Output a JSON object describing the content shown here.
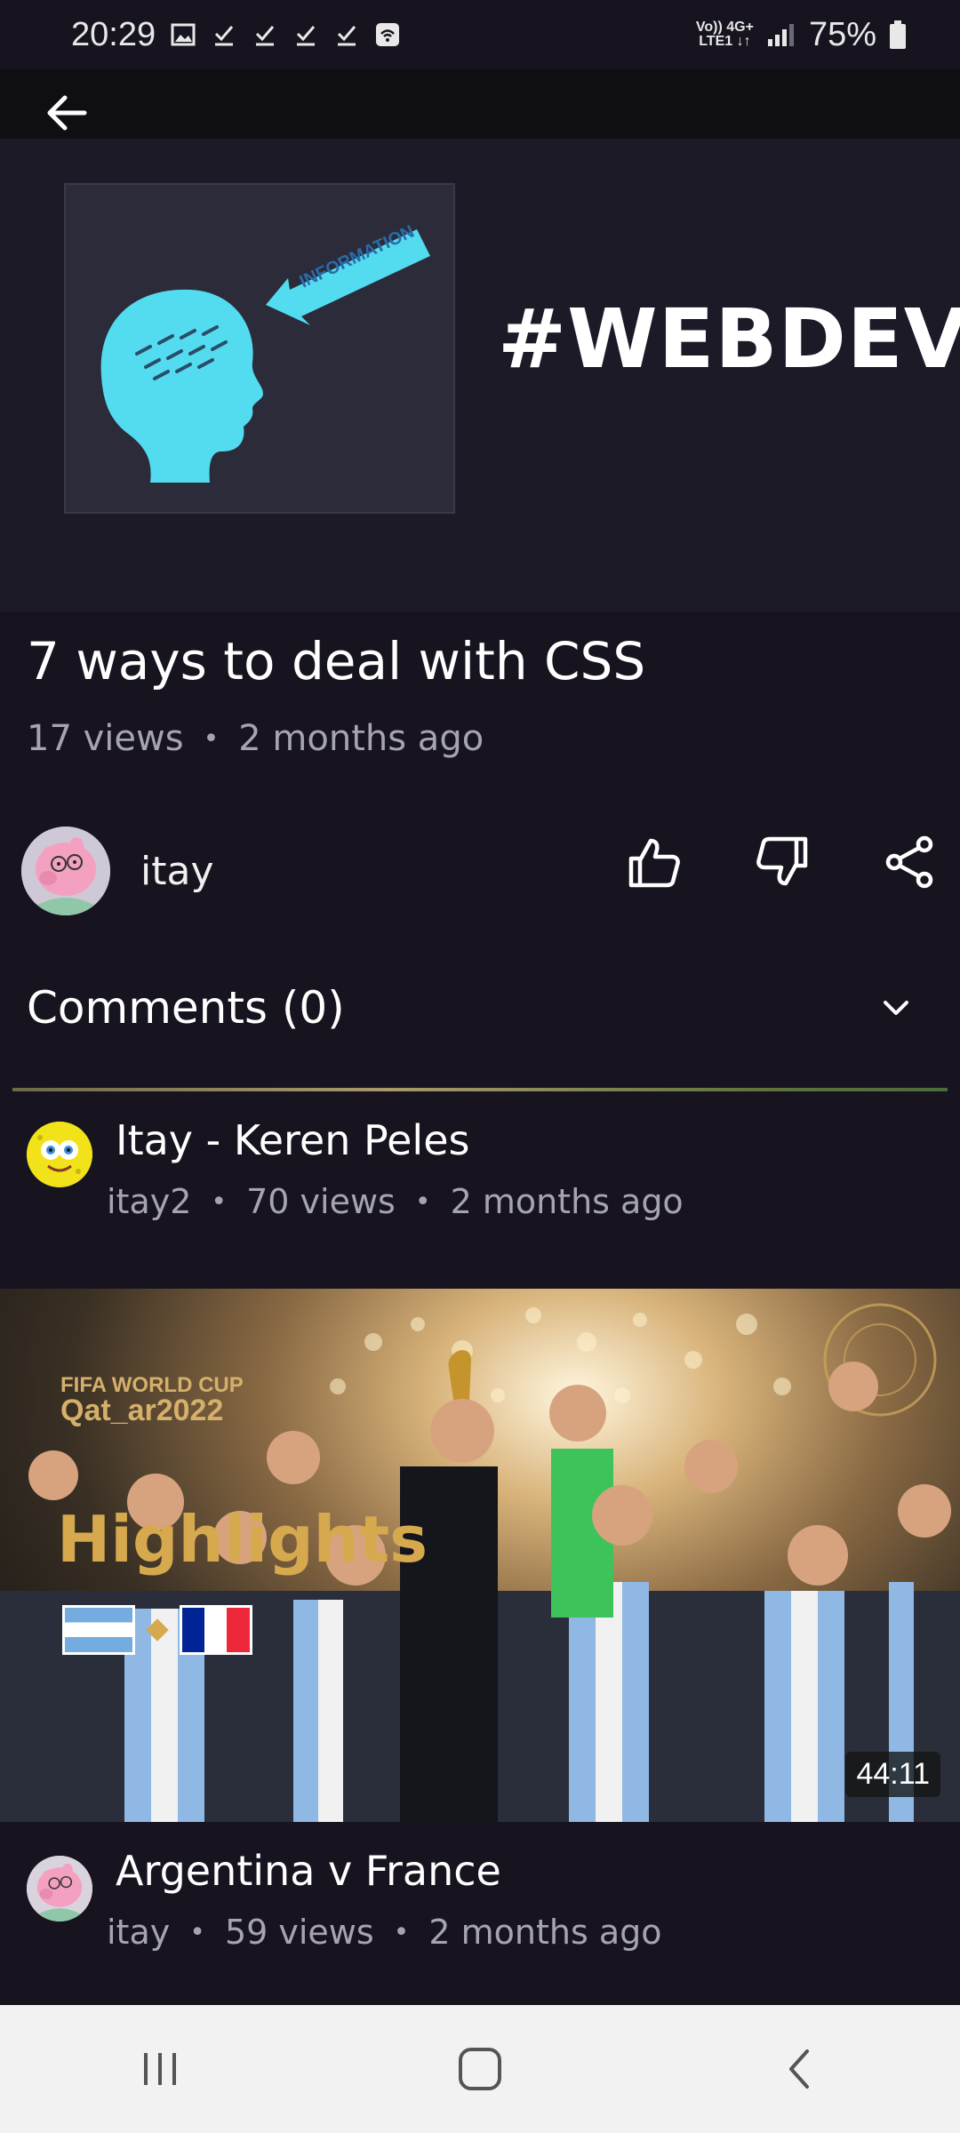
{
  "status_bar": {
    "time": "20:29",
    "network_top": "Vo)) 4G+",
    "network_bottom": "LTE1 ↓↑",
    "battery": "75%"
  },
  "player": {
    "thumbnail_text": "#WEBDEV",
    "arrow_label": "INFORMATION"
  },
  "video": {
    "title": "7 ways to deal with CSS",
    "views": "17 views",
    "age": "2 months ago"
  },
  "channel": {
    "name": "itay"
  },
  "comments": {
    "label": "Comments (0)"
  },
  "recommended": [
    {
      "title": "Itay - Keren Peles",
      "channel": "itay2",
      "views": "70 views",
      "age": "2 months ago"
    },
    {
      "title": "Argentina v France",
      "channel": "itay",
      "views": "59 views",
      "age": "2 months ago",
      "duration": "44:11",
      "thumb_line1": "FIFA WORLD CUP",
      "thumb_line2": "Qat_ar2022",
      "thumb_highlight": "Highlights"
    }
  ],
  "icons": {
    "back": "arrow-left-icon",
    "like": "thumbs-up-icon",
    "dislike": "thumbs-down-icon",
    "share": "share-icon",
    "expand": "chevron-down-icon",
    "nav_recents": "recents-icon",
    "nav_home": "home-icon",
    "nav_back": "back-icon"
  },
  "colors": {
    "background": "#17141f",
    "muted_text": "#a7a4b2",
    "nav_bar": "#f2f2f2"
  }
}
